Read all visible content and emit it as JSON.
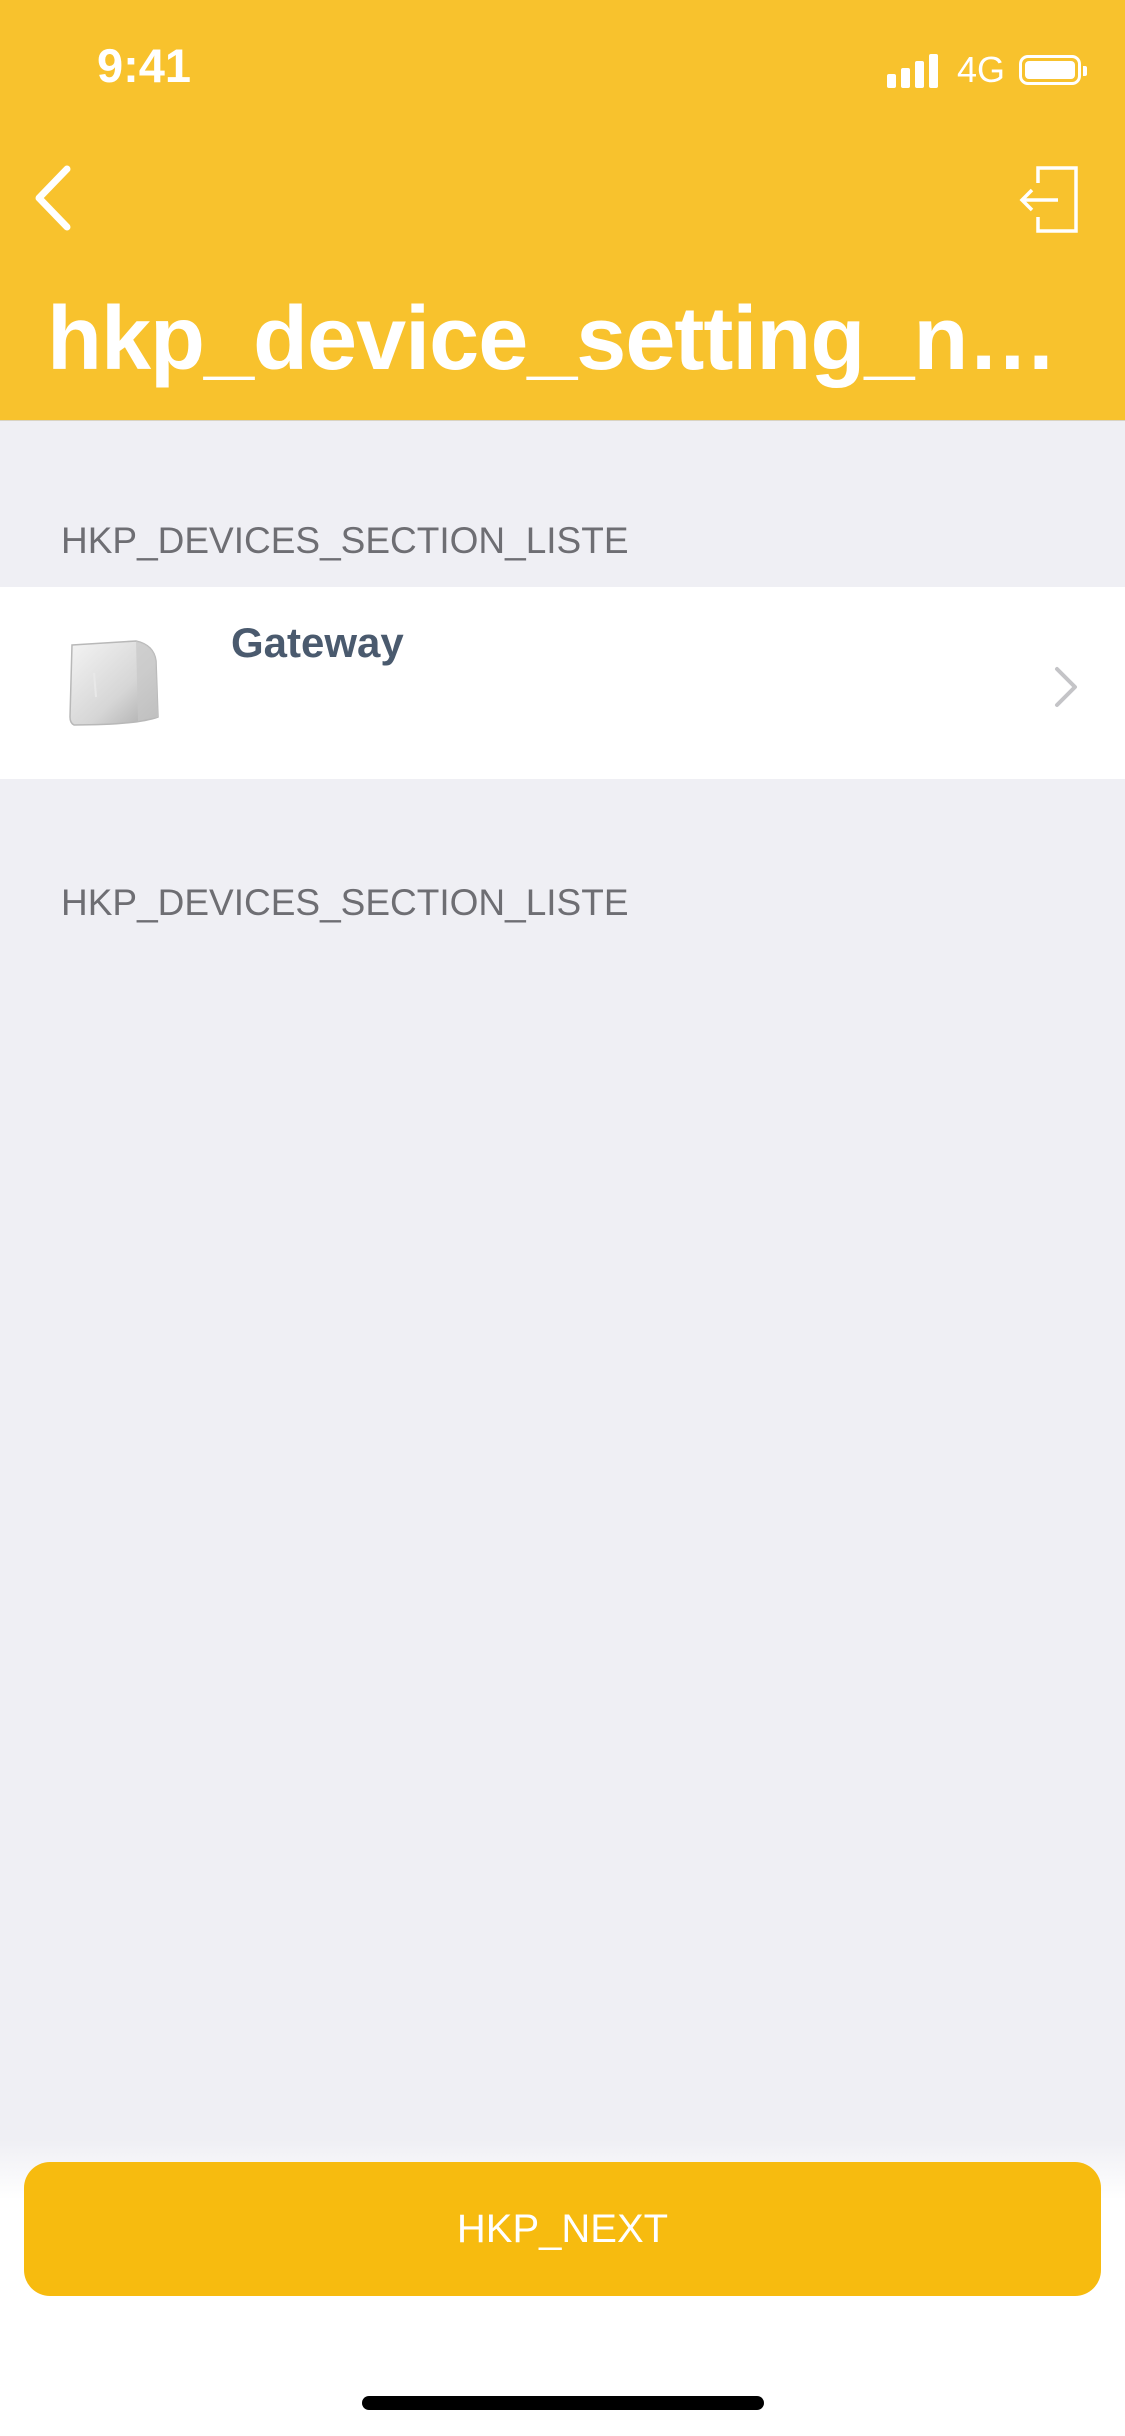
{
  "status_bar": {
    "time": "9:41",
    "network": "4G",
    "signal_bars": 4,
    "battery_level": 1.0
  },
  "nav": {
    "back_icon": "chevron-left-icon",
    "logout_icon": "logout-icon",
    "title": "hkp_device_setting_name_title"
  },
  "sections": [
    {
      "header": "HKP_DEVICES_SECTION_LISTE",
      "items": [
        {
          "name": "Gateway",
          "icon": "gateway-device-image",
          "accessory": "chevron-right-icon"
        }
      ]
    },
    {
      "header": "HKP_DEVICES_SECTION_LISTE",
      "items": []
    }
  ],
  "footer": {
    "next_label": "HKP_NEXT"
  },
  "colors": {
    "accent": "#f8c22d",
    "button": "#f7bb0f",
    "background": "#efeff4",
    "device_name": "#4a5a6e"
  }
}
